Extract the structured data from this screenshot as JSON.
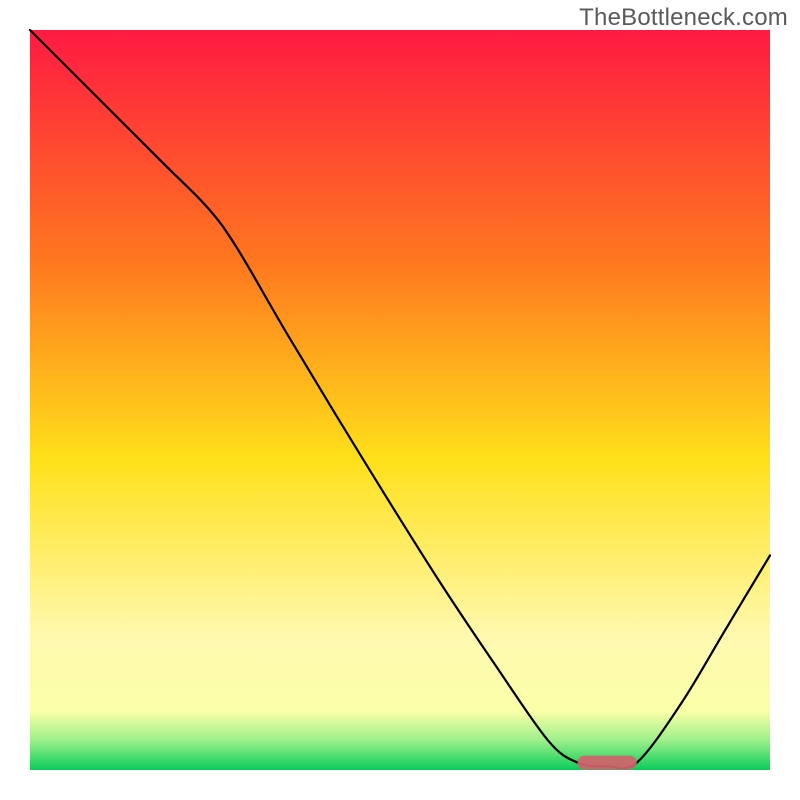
{
  "watermark": "TheBottleneck.com",
  "colors": {
    "grad_top": "#ff1a42",
    "grad_upper_mid": "#ff7a1f",
    "grad_mid": "#ffe01a",
    "grad_lower_mid": "#fff9b0",
    "grad_bottom_yellow": "#fbffa8",
    "grad_green_upper": "#9df08a",
    "grad_green_lower": "#0acc5a",
    "curve": "#000000",
    "marker_fill": "#d4626c",
    "marker_fill_alt": "#d4626c"
  },
  "layout": {
    "plot_inset": 30,
    "plot_size": 740
  },
  "chart_data": {
    "type": "line",
    "title": "",
    "xlabel": "",
    "ylabel": "",
    "categories": [],
    "x_range": [
      0,
      100
    ],
    "y_range": [
      0,
      100
    ],
    "curve_points_normalized": [
      {
        "x": 0.0,
        "y": 1.0
      },
      {
        "x": 0.1,
        "y": 0.9
      },
      {
        "x": 0.18,
        "y": 0.82
      },
      {
        "x": 0.24,
        "y": 0.76
      },
      {
        "x": 0.28,
        "y": 0.705
      },
      {
        "x": 0.35,
        "y": 0.585
      },
      {
        "x": 0.45,
        "y": 0.42
      },
      {
        "x": 0.55,
        "y": 0.26
      },
      {
        "x": 0.63,
        "y": 0.14
      },
      {
        "x": 0.7,
        "y": 0.04
      },
      {
        "x": 0.74,
        "y": 0.01
      },
      {
        "x": 0.78,
        "y": 0.005
      },
      {
        "x": 0.82,
        "y": 0.01
      },
      {
        "x": 0.88,
        "y": 0.09
      },
      {
        "x": 0.94,
        "y": 0.19
      },
      {
        "x": 1.0,
        "y": 0.29
      }
    ],
    "optimum_marker": {
      "x_start_norm": 0.74,
      "x_end_norm": 0.82,
      "y_norm": 0.01
    }
  }
}
